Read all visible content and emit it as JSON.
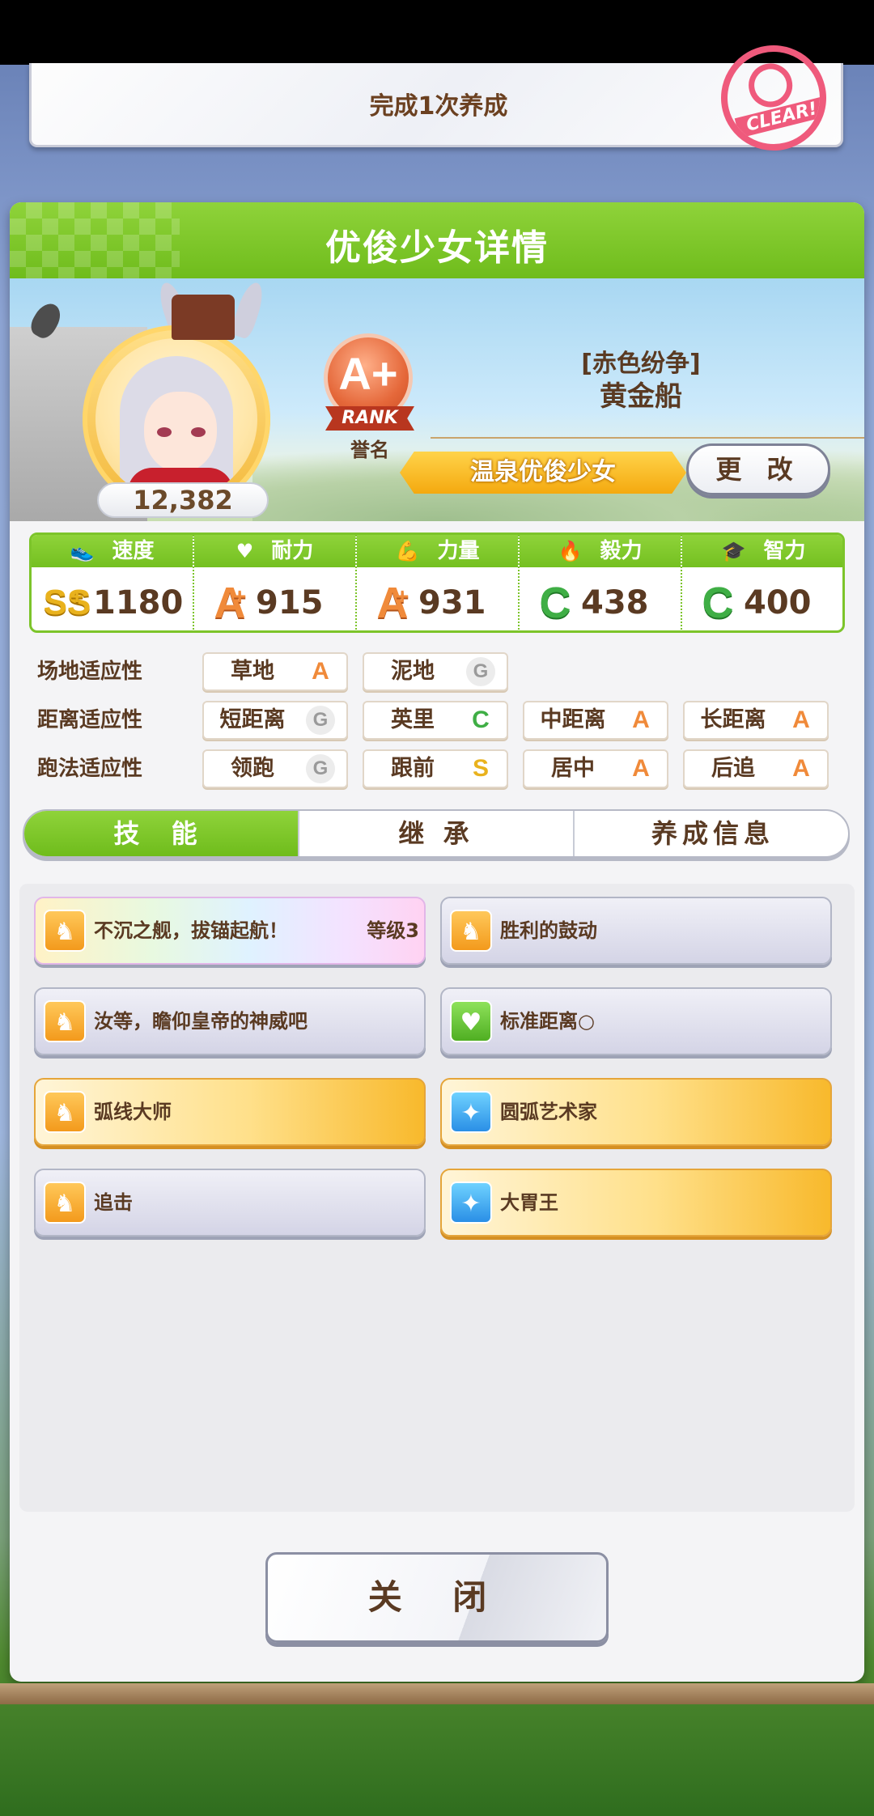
{
  "mission": {
    "text": "完成1次养成",
    "stamp": "CLEAR!"
  },
  "panel": {
    "title": "优俊少女详情",
    "score": "12,382",
    "rank": {
      "grade": "A+",
      "ribbon": "RANK",
      "label": "誉名"
    },
    "character": {
      "epithet": "[赤色纷争]",
      "name": "黄金船"
    },
    "title_badge": "温泉优俊少女",
    "change_button": "更 改"
  },
  "stats": [
    {
      "label": "速度",
      "icon": "shoe-icon",
      "grade": "SS",
      "plus": "+",
      "value": "1180"
    },
    {
      "label": "耐力",
      "icon": "heart-icon",
      "grade": "A",
      "plus": "+",
      "value": "915"
    },
    {
      "label": "力量",
      "icon": "muscle-icon",
      "grade": "A",
      "plus": "+",
      "value": "931"
    },
    {
      "label": "毅力",
      "icon": "flame-icon",
      "grade": "C",
      "plus": "",
      "value": "438"
    },
    {
      "label": "智力",
      "icon": "graduation-cap-icon",
      "grade": "C",
      "plus": "",
      "value": "400"
    }
  ],
  "aptitudes": {
    "field": {
      "label": "场地适应性",
      "items": [
        {
          "name": "草地",
          "grade": "A"
        },
        {
          "name": "泥地",
          "grade": "G"
        }
      ]
    },
    "distance": {
      "label": "距离适应性",
      "items": [
        {
          "name": "短距离",
          "grade": "G"
        },
        {
          "name": "英里",
          "grade": "C"
        },
        {
          "name": "中距离",
          "grade": "A"
        },
        {
          "name": "长距离",
          "grade": "A"
        }
      ]
    },
    "style": {
      "label": "跑法适应性",
      "items": [
        {
          "name": "领跑",
          "grade": "G"
        },
        {
          "name": "跟前",
          "grade": "S"
        },
        {
          "name": "居中",
          "grade": "A"
        },
        {
          "name": "后追",
          "grade": "A"
        }
      ]
    }
  },
  "tabs": [
    "技 能",
    "继 承",
    "养成信息"
  ],
  "skills": [
    {
      "name": "不沉之舰，拔锚起航！",
      "level": "等级3",
      "icon": "horse-icon",
      "style": "rainbow"
    },
    {
      "name": "胜利的鼓动",
      "level": "",
      "icon": "horse-icon",
      "style": "normal"
    },
    {
      "name": "汝等，瞻仰皇帝的神威吧",
      "level": "",
      "icon": "horse-icon",
      "style": "normal"
    },
    {
      "name": "标准距离○",
      "level": "",
      "icon": "heart-icon",
      "style": "normal"
    },
    {
      "name": "弧线大师",
      "level": "",
      "icon": "horse-icon",
      "style": "gold"
    },
    {
      "name": "圆弧艺术家",
      "level": "",
      "icon": "sparkle-icon",
      "style": "gold"
    },
    {
      "name": "追击",
      "level": "",
      "icon": "horse-icon",
      "style": "normal"
    },
    {
      "name": "大胃王",
      "level": "",
      "icon": "sparkle-icon",
      "style": "gold"
    }
  ],
  "close_button": "关 闭"
}
